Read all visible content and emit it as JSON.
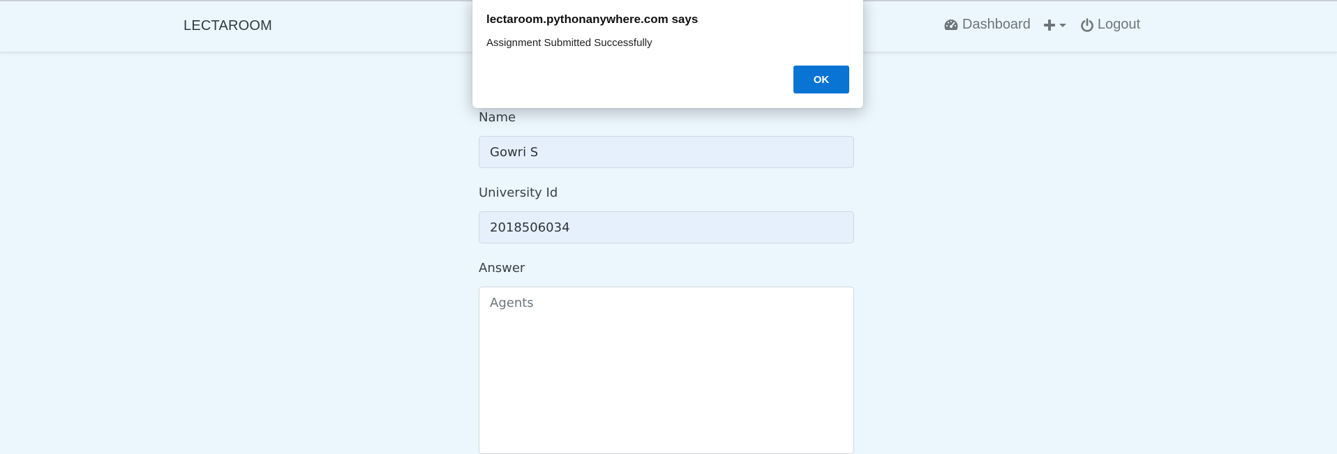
{
  "navbar": {
    "brand": "LECTAROOM",
    "items": [
      {
        "label": "Dashboard",
        "icon": "tachometer-icon"
      },
      {
        "label": "",
        "icon": "plus-icon",
        "dropdown": true
      },
      {
        "label": "Logout",
        "icon": "power-icon"
      }
    ]
  },
  "form": {
    "name_label": "Name",
    "name_value": "Gowri S",
    "university_id_label": "University Id",
    "university_id_value": "2018506034",
    "answer_label": "Answer",
    "answer_value": "Agents"
  },
  "dialog": {
    "title": "lectaroom.pythonanywhere.com says",
    "message": "Assignment Submitted Successfully",
    "ok_label": "OK"
  },
  "colors": {
    "page_background": "#ebf6fd",
    "ok_button": "#0a74d4",
    "input_background": "#e6f0fc"
  }
}
